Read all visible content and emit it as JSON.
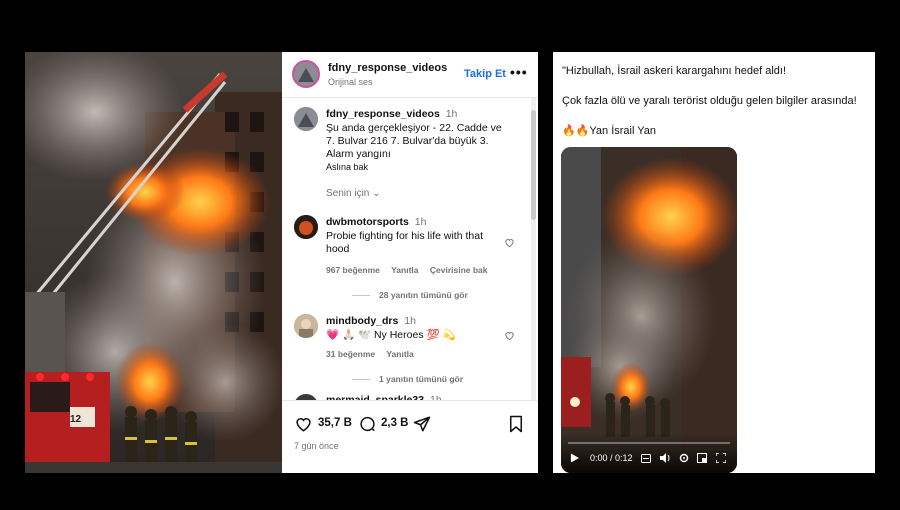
{
  "instagram": {
    "header": {
      "username": "fdny_response_videos",
      "subtitle": "Orijinal ses",
      "follow_label": "Takip Et",
      "more_label": "•••"
    },
    "caption": {
      "username": "fdny_response_videos",
      "time": "1h",
      "text": "Şu anda gerçekleşiyor - 22. Cadde ve 7. Bulvar 216 7. Bulvar'da büyük 3. Alarm yangını",
      "translation_link": "Aslına bak"
    },
    "filter_label": "Senin için",
    "comments": [
      {
        "username": "dwbmotorsports",
        "time": "1h",
        "text": "Probie fighting for his life with that hood",
        "likes": "967 beğenme",
        "reply": "Yanıtla",
        "translate": "Çevirisine bak",
        "view_replies": "28 yanıtın tümünü gör"
      },
      {
        "username": "mindbody_drs",
        "time": "1h",
        "text": "💗 🙏🏻 🕊️ Ny Heroes 💯 💫",
        "likes": "31 beğenme",
        "reply": "Yanıtla",
        "view_replies": "1 yanıtın tümünü gör"
      },
      {
        "username": "mermaid_sparkle33",
        "time": "1h"
      }
    ],
    "actions": {
      "like_count": "35,7 B",
      "comment_count": "2,3 B"
    },
    "posted": "7 gün önce"
  },
  "tweet": {
    "line1": "\"Hizbullah, İsrail askeri karargahını hedef aldı!",
    "line2": "Çok fazla ölü ve yaralı terörist olduğu gelen bilgiler arasında!",
    "line3": "🔥🔥Yan İsrail Yan",
    "video_time": "0:00 / 0:12"
  },
  "colors": {
    "accent": "#1c6fe0",
    "muted": "#737373",
    "background": "#000000"
  }
}
